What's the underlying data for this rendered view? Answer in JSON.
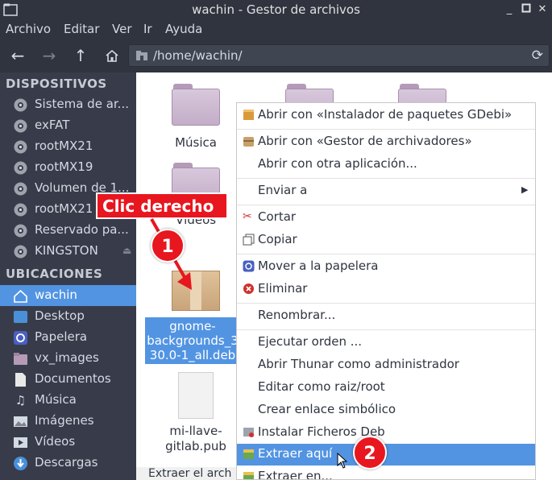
{
  "window": {
    "title": "wachin - Gestor de archivos"
  },
  "menubar": [
    "Archivo",
    "Editar",
    "Ver",
    "Ir",
    "Ayuda"
  ],
  "address": {
    "path": "/home/wachin/"
  },
  "sidebar": {
    "devices_header": "DISPOSITIVOS",
    "devices": [
      {
        "label": "Sistema de ar...",
        "icon": "drive-icon"
      },
      {
        "label": "exFAT",
        "icon": "drive-icon"
      },
      {
        "label": "rootMX21",
        "icon": "drive-icon"
      },
      {
        "label": "rootMX19",
        "icon": "drive-icon"
      },
      {
        "label": "Volumen de 1...",
        "icon": "drive-icon"
      },
      {
        "label": "rootMX21",
        "icon": "drive-icon"
      },
      {
        "label": "Reservado pa...",
        "icon": "drive-icon"
      },
      {
        "label": "KINGSTON",
        "icon": "drive-icon"
      }
    ],
    "places_header": "UBICACIONES",
    "places": [
      {
        "label": "wachin",
        "icon": "home-icon",
        "selected": true
      },
      {
        "label": "Desktop",
        "icon": "desktop-icon"
      },
      {
        "label": "Papelera",
        "icon": "trash-icon"
      },
      {
        "label": "vx_images",
        "icon": "folder-icon"
      },
      {
        "label": "Documentos",
        "icon": "document-icon"
      },
      {
        "label": "Música",
        "icon": "music-icon"
      },
      {
        "label": "Imágenes",
        "icon": "image-icon"
      },
      {
        "label": "Vídeos",
        "icon": "video-icon"
      },
      {
        "label": "Descargas",
        "icon": "download-icon"
      }
    ]
  },
  "files": {
    "musica": "Música",
    "videos": "Vídeos",
    "deb_line1": "gnome-",
    "deb_line2": "backgrounds_3",
    "deb_line3": "30.0-1_all.deb",
    "pub_line1": "mi-llave-",
    "pub_line2": "gitlab.pub"
  },
  "context_menu": {
    "open_gdebi": "Abrir con «Instalador de paquetes GDebi»",
    "open_archiver": "Abrir con «Gestor de archivadores»",
    "open_other": "Abrir con otra aplicación...",
    "send_to": "Enviar a",
    "cut": "Cortar",
    "copy": "Copiar",
    "move_trash": "Mover a la papelera",
    "delete": "Eliminar",
    "rename": "Renombrar...",
    "run_command": "Ejecutar orden ...",
    "open_thunar_admin": "Abrir Thunar como administrador",
    "edit_root": "Editar como raiz/root",
    "create_symlink": "Crear enlace simbólico",
    "install_deb": "Instalar Ficheros Deb",
    "extract_here": "Extraer aquí",
    "extract_to": "Extraer en..."
  },
  "status_text": "Extraer el arch",
  "annotations": {
    "callout_text": "Clic derecho",
    "badge1": "1",
    "badge2": "2"
  },
  "colors": {
    "accent": "#5294e2",
    "annotation": "#e8161e",
    "sidebar_bg": "#383c4a"
  }
}
